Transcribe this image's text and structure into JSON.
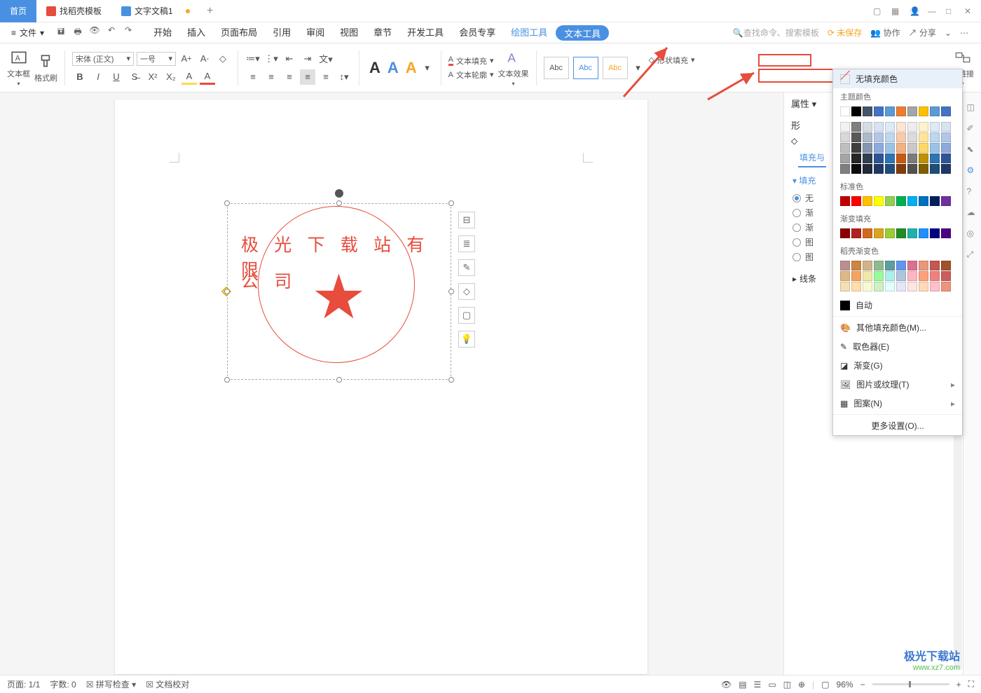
{
  "tabs": {
    "home": "首页",
    "template": "找稻壳模板",
    "doc": "文字文稿1"
  },
  "menu": {
    "file": "文件",
    "items": [
      "开始",
      "插入",
      "页面布局",
      "引用",
      "审阅",
      "视图",
      "章节",
      "开发工具",
      "会员专享"
    ],
    "draw_tool": "绘图工具",
    "text_tool": "文本工具",
    "search_placeholder": "查找命令、搜索模板",
    "unsaved": "未保存",
    "collab": "协作",
    "share": "分享"
  },
  "ribbon": {
    "textbox": "文本框",
    "format_brush": "格式刷",
    "font_name": "宋体 (正文)",
    "font_size": "一号",
    "text_fill": "文本填充",
    "text_outline": "文本轮廓",
    "text_effect": "文本效果",
    "style_abc": "Abc",
    "shape_fill": "形状填充",
    "link_box": "框链接"
  },
  "seal": {
    "line1": "极 光 下 载 站 有 限",
    "line2": "公 司"
  },
  "side": {
    "prop": "属性",
    "shape": "形",
    "fill_tab": "填充与",
    "fill_section": "填充",
    "no_fill_radio": "无",
    "gradient_radio": "渐",
    "third_radio": "渐",
    "fourth_radio": "图",
    "line_section": "线条"
  },
  "popup": {
    "no_fill": "无填充颜色",
    "theme": "主题颜色",
    "standard": "标准色",
    "gradient_fill": "渐变填充",
    "doke_gradient": "稻壳渐变色",
    "auto": "自动",
    "more_fill": "其他填充颜色(M)...",
    "eyedropper": "取色器(E)",
    "gradient": "渐变(G)",
    "pic_texture": "图片或纹理(T)",
    "pattern": "图案(N)",
    "more_settings": "更多设置(O)..."
  },
  "palettes": {
    "theme_row1": [
      "#ffffff",
      "#000000",
      "#44546a",
      "#4472c4",
      "#5b9bd5",
      "#ed7d31",
      "#a5a5a5",
      "#ffc000",
      "#5b9bd5",
      "#4472c4"
    ],
    "theme_shades": [
      [
        "#f2f2f2",
        "#7f7f7f",
        "#d6dce4",
        "#d9e2f3",
        "#deebf6",
        "#fbe5d5",
        "#ededed",
        "#fff2cc",
        "#deebf6",
        "#d9e2f3"
      ],
      [
        "#d8d8d8",
        "#595959",
        "#adb9ca",
        "#b4c6e7",
        "#bdd7ee",
        "#f7cbac",
        "#dbdbdb",
        "#fee599",
        "#bdd7ee",
        "#b4c6e7"
      ],
      [
        "#bfbfbf",
        "#3f3f3f",
        "#8496b0",
        "#8eaadb",
        "#9cc3e5",
        "#f4b183",
        "#c9c9c9",
        "#ffd965",
        "#9cc3e5",
        "#8eaadb"
      ],
      [
        "#a5a5a5",
        "#262626",
        "#323f4f",
        "#2f5496",
        "#2e75b5",
        "#c55a11",
        "#7b7b7b",
        "#bf9000",
        "#2e75b5",
        "#2f5496"
      ],
      [
        "#7f7f7f",
        "#0c0c0c",
        "#222a35",
        "#1f3864",
        "#1e4e79",
        "#833c0b",
        "#525252",
        "#7f6000",
        "#1e4e79",
        "#1f3864"
      ]
    ],
    "standard": [
      "#c00000",
      "#ff0000",
      "#ffc000",
      "#ffff00",
      "#92d050",
      "#00b050",
      "#00b0f0",
      "#0070c0",
      "#002060",
      "#7030a0"
    ],
    "gradient_row": [
      "#8b0000",
      "#b22222",
      "#d2691e",
      "#daa520",
      "#9acd32",
      "#228b22",
      "#20b2aa",
      "#1e90ff",
      "#000080",
      "#4b0082"
    ],
    "doke": [
      [
        "#bc8f8f",
        "#cd853f",
        "#d2b48c",
        "#8fbc8f",
        "#5f9ea0",
        "#6495ed",
        "#db7093",
        "#e9967a",
        "#c45850",
        "#a0522d"
      ],
      [
        "#deb887",
        "#f4a460",
        "#eee8aa",
        "#98fb98",
        "#afeeee",
        "#b0c4de",
        "#ffb6c1",
        "#ffa07a",
        "#f08080",
        "#cd5c5c"
      ],
      [
        "#f5deb3",
        "#ffdead",
        "#fafad2",
        "#d0f0c0",
        "#e0ffff",
        "#e6e6fa",
        "#ffe4e1",
        "#ffdab9",
        "#ffc0cb",
        "#e9967a"
      ]
    ]
  },
  "status": {
    "page": "页面: 1/1",
    "words": "字数: 0",
    "spell": "拼写检查",
    "proof": "文档校对",
    "zoom": "96%"
  },
  "watermark": {
    "top": "极光下载站",
    "bot": "www.xz7.com"
  }
}
